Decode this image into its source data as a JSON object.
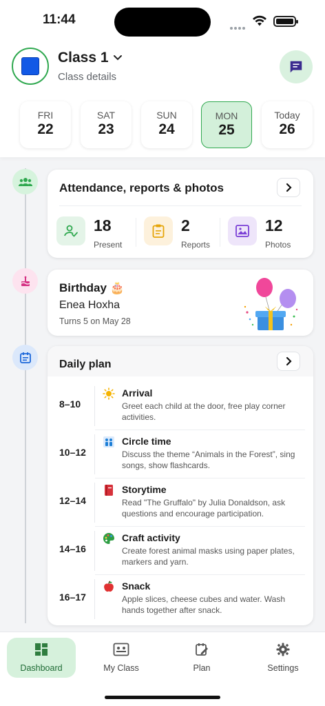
{
  "status_bar": {
    "time": "11:44"
  },
  "header": {
    "title": "Class 1",
    "subtitle": "Class details"
  },
  "days": [
    {
      "name": "FRI",
      "date": "22",
      "selected": false
    },
    {
      "name": "SAT",
      "date": "23",
      "selected": false
    },
    {
      "name": "SUN",
      "date": "24",
      "selected": false
    },
    {
      "name": "MON",
      "date": "25",
      "selected": true
    },
    {
      "name": "Today",
      "date": "26",
      "selected": false
    }
  ],
  "attendance": {
    "title": "Attendance, reports & photos",
    "stats": [
      {
        "value": "18",
        "label": "Present",
        "icon": "person-check-icon"
      },
      {
        "value": "2",
        "label": "Reports",
        "icon": "clipboard-icon"
      },
      {
        "value": "12",
        "label": "Photos",
        "icon": "image-icon"
      }
    ]
  },
  "birthday": {
    "title": "Birthday 🎂",
    "name": "Enea Hoxha",
    "detail": "Turns 5 on May 28"
  },
  "daily_plan": {
    "title": "Daily plan",
    "items": [
      {
        "time": "8–10",
        "title": "Arrival",
        "desc": "Greet each child at the door, free play corner activities.",
        "icon": "sun-icon"
      },
      {
        "time": "10–12",
        "title": "Circle time",
        "desc": "Discuss the theme “Animals in the Forest”, sing songs, show flashcards.",
        "icon": "people-icon"
      },
      {
        "time": "12–14",
        "title": "Storytime",
        "desc": "Read \"The Gruffalo\" by Julia Donaldson, ask questions and encourage participation.",
        "icon": "book-icon"
      },
      {
        "time": "14–16",
        "title": "Craft activity",
        "desc": "Create forest animal masks using paper plates, markers and yarn.",
        "icon": "palette-icon"
      },
      {
        "time": "16–17",
        "title": "Snack",
        "desc": "Apple slices, cheese cubes and water. Wash hands together after snack.",
        "icon": "apple-icon"
      }
    ]
  },
  "tabs": [
    {
      "label": "Dashboard",
      "icon": "dashboard-icon",
      "active": true
    },
    {
      "label": "My Class",
      "icon": "class-icon",
      "active": false
    },
    {
      "label": "Plan",
      "icon": "plan-icon",
      "active": false
    },
    {
      "label": "Settings",
      "icon": "gear-icon",
      "active": false
    }
  ],
  "colors": {
    "accent": "#2fa84f",
    "accent_bg": "#d6f1dc",
    "class_square": "#1259e6",
    "chat_icon": "#3b2b8f"
  }
}
